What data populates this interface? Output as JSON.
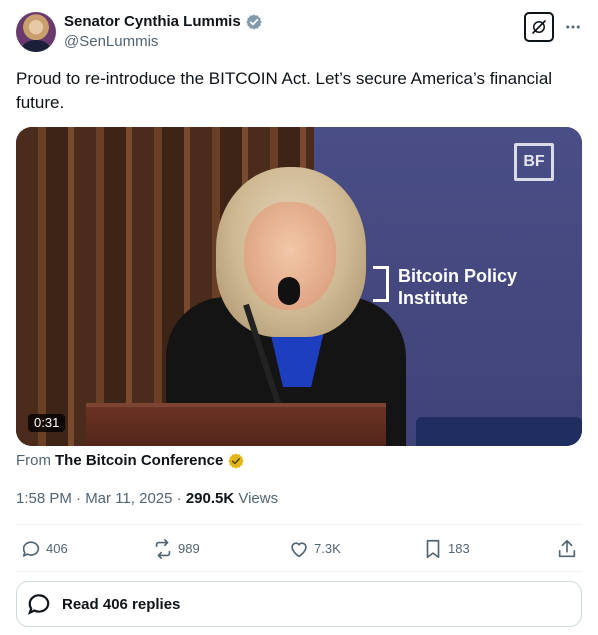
{
  "author": {
    "display_name": "Senator Cynthia Lummis",
    "handle": "@SenLummis"
  },
  "tweet": {
    "text": "Proud to re-introduce the BITCOIN Act. Let’s secure America’s financial future."
  },
  "media": {
    "duration": "0:31",
    "backdrop_text_line1": "Bitcoin Policy",
    "backdrop_text_line2": "Institute",
    "watermark": "BF"
  },
  "source": {
    "from_label": "From",
    "account": "The Bitcoin Conference"
  },
  "meta": {
    "time": "1:58 PM · Mar 11, 2025",
    "separator": " · ",
    "views_count": "290.5K",
    "views_label": "Views"
  },
  "actions": {
    "replies": "406",
    "reposts": "989",
    "likes": "7.3K",
    "bookmarks": "183"
  },
  "read_replies": {
    "label": "Read 406 replies"
  },
  "colors": {
    "verified_blue": "#829aab",
    "gold_badge": "#e2b719",
    "text_primary": "#0f1419",
    "text_secondary": "#536471"
  }
}
